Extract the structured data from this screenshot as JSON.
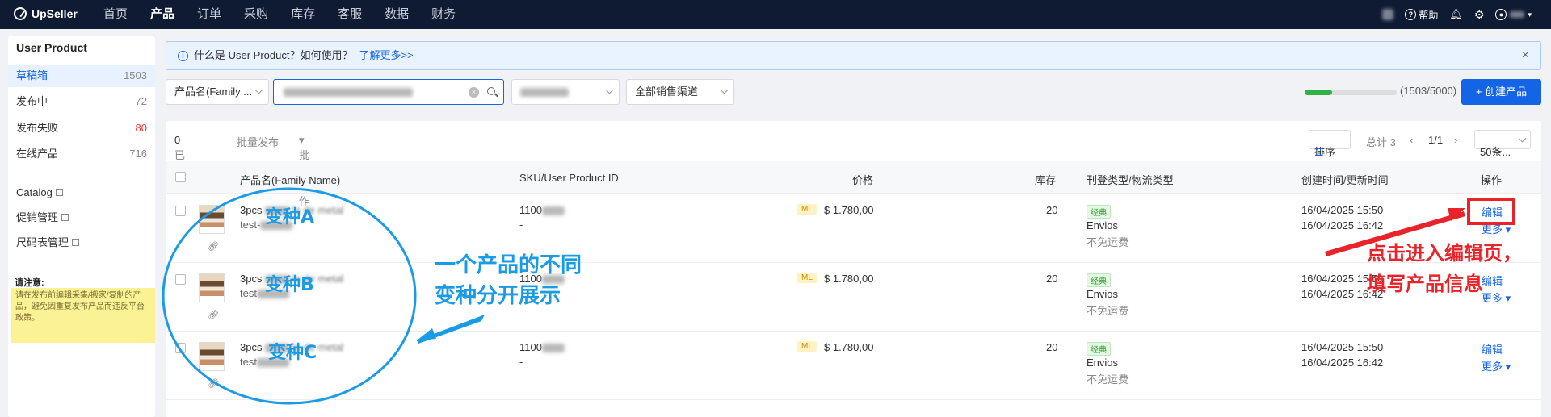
{
  "topbar": {
    "logo": "UpSeller",
    "nav": [
      "首页",
      "产品",
      "订单",
      "采购",
      "库存",
      "客服",
      "数据",
      "财务"
    ],
    "active_nav": "产品",
    "help": "帮助"
  },
  "sidebar": {
    "title": "User Product",
    "items": [
      {
        "label": "草稿箱",
        "count": "1503"
      },
      {
        "label": "发布中",
        "count": "72"
      },
      {
        "label": "发布失败",
        "count": "80"
      },
      {
        "label": "在线产品",
        "count": "716"
      }
    ],
    "links": [
      "Catalog",
      "促销管理",
      "尺码表管理"
    ],
    "notice_title": "请注意:",
    "notice_text": "请在发布前编辑采集/搬家/复制的产品，避免因重复发布产品而违反平台政策。"
  },
  "banner": {
    "text": "什么是 User Product？如何使用？",
    "link": "了解更多>>",
    "close": "×"
  },
  "filters": {
    "field": "产品名(Family ...",
    "channel": "全部销售渠道",
    "progress": 0.3006,
    "count_text": "(1503/5000)",
    "create_btn": "+ 创建产品"
  },
  "toolbar": {
    "selected_label": "已选择",
    "selected_count": "0",
    "batch_publish": "批量发布",
    "batch_ops": "批量操作",
    "sort": "排序",
    "total": "总计 3",
    "page": "1/1",
    "per_page": "50条..."
  },
  "columns": [
    "产品名(Family Name)",
    "SKU/User Product ID",
    "价格",
    "库存",
    "刊登类型/物流类型",
    "创建时间/更新时间",
    "操作"
  ],
  "rows": [
    {
      "name": "3pcs",
      "name_tail": "la de metal",
      "sub": "test-",
      "sku": "1100",
      "id": "-",
      "ml": "ML",
      "price": "$ 1.780,00",
      "stock": "20",
      "tag": "经典",
      "ship": "Envios",
      "fee": "不免运费",
      "created": "16/04/2025 15:50",
      "updated": "16/04/2025 16:42",
      "edit": "编辑",
      "more": "更多"
    },
    {
      "name": "3pcs",
      "name_tail": "la de metal",
      "sub": "test",
      "sku": "1100",
      "id": "-",
      "ml": "ML",
      "price": "$ 1.780,00",
      "stock": "20",
      "tag": "经典",
      "ship": "Envios",
      "fee": "不免运费",
      "created": "16/04/2025 15:50",
      "updated": "16/04/2025 16:42",
      "edit": "编辑",
      "more": "更多"
    },
    {
      "name": "3pcs",
      "name_tail": "la de metal",
      "sub": "test",
      "sku": "1100",
      "id": "-",
      "ml": "ML",
      "price": "$ 1.780,00",
      "stock": "20",
      "tag": "经典",
      "ship": "Envios",
      "fee": "不免运费",
      "created": "16/04/2025 15:50",
      "updated": "16/04/2025 16:42",
      "edit": "编辑",
      "more": "更多"
    }
  ],
  "annotations": {
    "variant_a": "变种A",
    "variant_b": "变种B",
    "variant_c": "变种C",
    "desc_line1": "一个产品的不同",
    "desc_line2": "变种分开展示",
    "edit_line1": "点击进入编辑页，",
    "edit_line2": "填写产品信息"
  },
  "colors": {
    "accent": "#1464e6",
    "topbar": "#0f1b33",
    "annotation_blue": "#1a9be6",
    "annotation_red": "#e8242a"
  }
}
